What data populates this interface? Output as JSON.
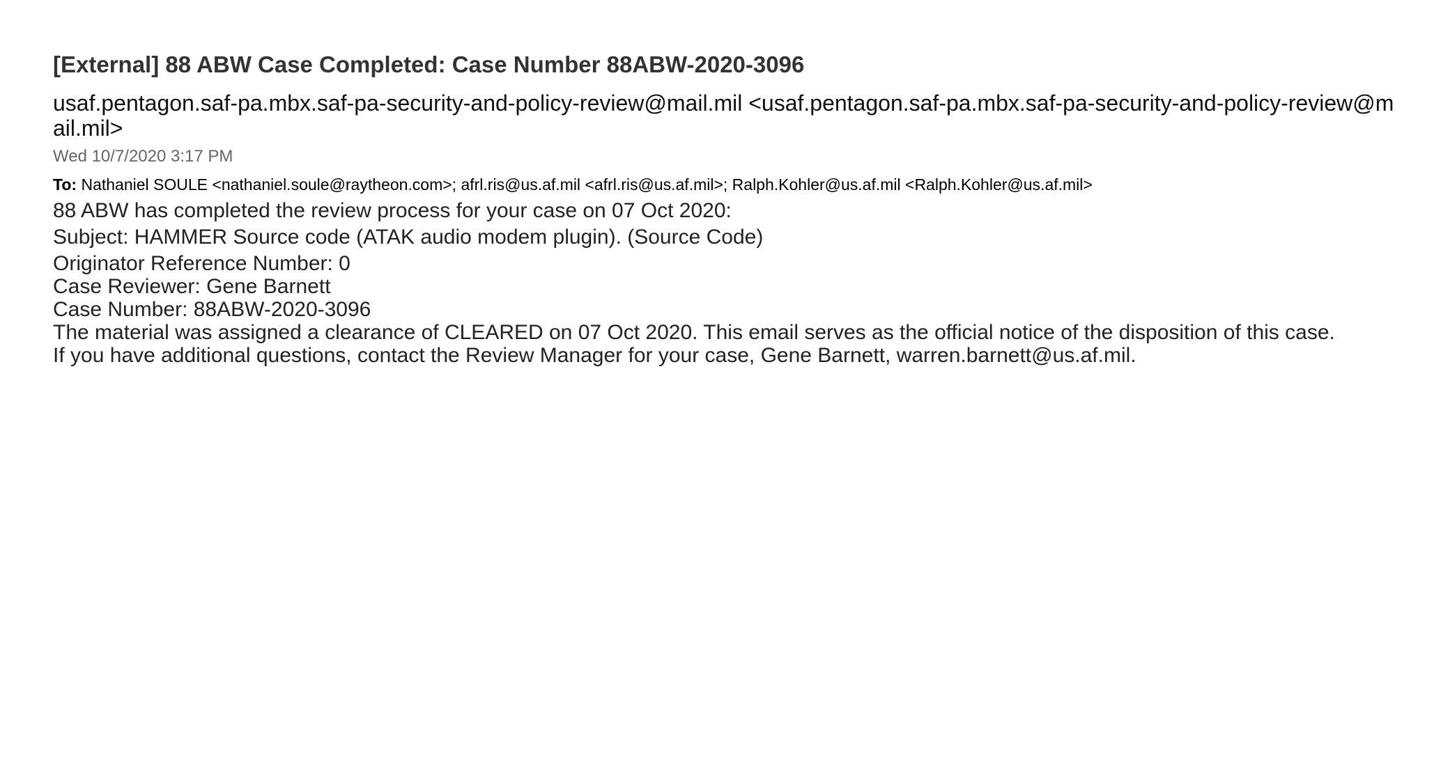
{
  "email": {
    "subject": "[External] 88 ABW Case Completed: Case Number 88ABW-2020-3096",
    "sender": "usaf.pentagon.saf-pa.mbx.saf-pa-security-and-policy-review@mail.mil <usaf.pentagon.saf-pa.mbx.saf-pa-security-and-policy-review@mail.mil>",
    "date": "Wed 10/7/2020 3:17 PM",
    "to_label": "To:",
    "to_recipients": "Nathaniel SOULE <nathaniel.soule@raytheon.com>; afrl.ris@us.af.mil <afrl.ris@us.af.mil>; Ralph.Kohler@us.af.mil <Ralph.Kohler@us.af.mil>",
    "body": [
      "88 ABW has completed the review process for your case on 07 Oct 2020:",
      "Subject: HAMMER Source code (ATAK audio modem plugin). (Source Code)",
      "Originator Reference Number: 0",
      "Case Reviewer: Gene Barnett",
      "Case Number: 88ABW-2020-3096",
      "The material was assigned a clearance of CLEARED on 07 Oct 2020. This email serves as the official notice of the disposition of this case.",
      "If you have additional questions, contact the Review Manager for your case, Gene Barnett, warren.barnett@us.af.mil."
    ]
  }
}
